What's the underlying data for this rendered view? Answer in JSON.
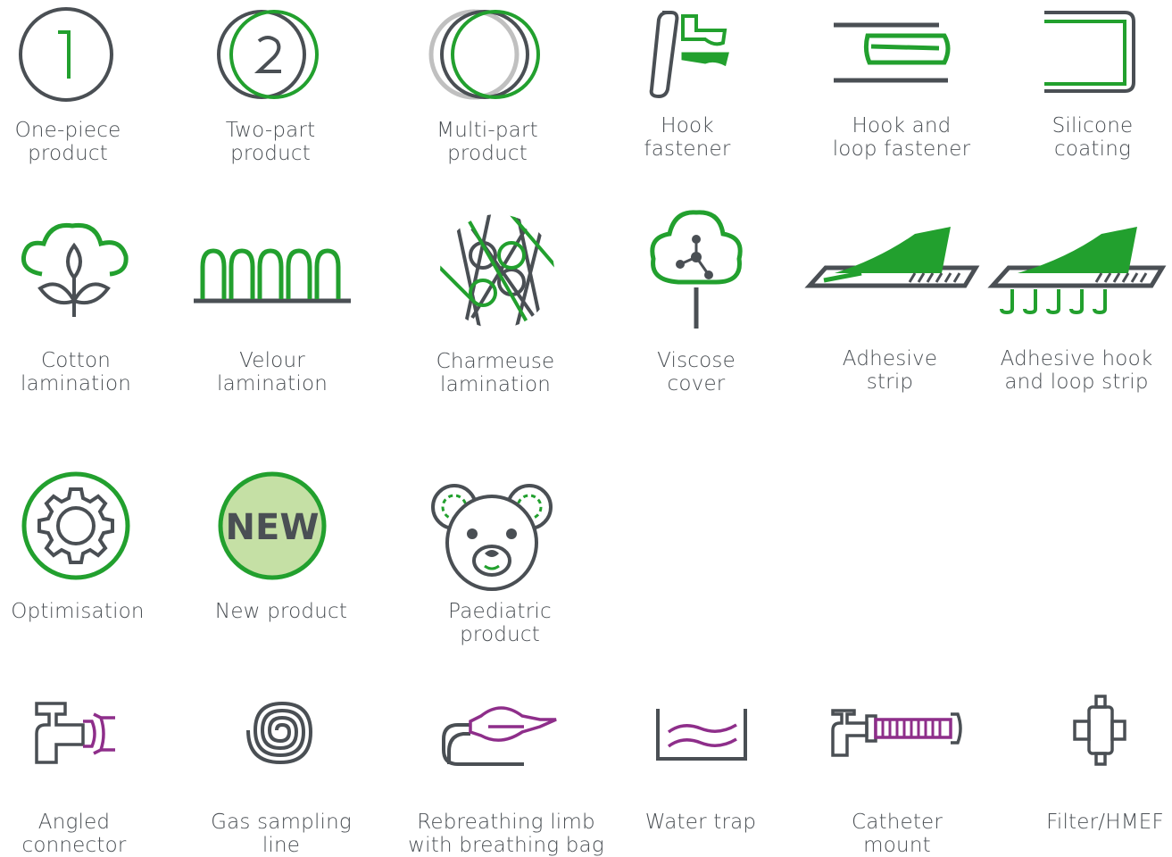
{
  "colors": {
    "dark": "#4a4f54",
    "green": "#22a02e",
    "lightgray": "#c0c0c0",
    "purple": "#8e2e8a",
    "newfill": "#c5e0a5"
  },
  "icons": {
    "one_piece": {
      "line1": "One-piece",
      "line2": "product",
      "icon": "circle-one-icon"
    },
    "two_part": {
      "line1": "Two-part",
      "line2": "product",
      "icon": "circle-two-icon"
    },
    "multi_part": {
      "line1": "Multi-part",
      "line2": "product",
      "icon": "multi-circle-icon"
    },
    "hook": {
      "line1": "Hook",
      "line2": "fastener",
      "icon": "hook-fastener-icon"
    },
    "hook_loop": {
      "line1": "Hook and",
      "line2": "loop fastener",
      "icon": "hook-loop-fastener-icon"
    },
    "silicone": {
      "line1": "Silicone",
      "line2": "coating",
      "icon": "silicone-coating-icon"
    },
    "cotton": {
      "line1": "Cotton",
      "line2": "lamination",
      "icon": "cotton-icon"
    },
    "velour": {
      "line1": "Velour",
      "line2": "lamination",
      "icon": "velour-icon"
    },
    "charmeuse": {
      "line1": "Charmeuse",
      "line2": "lamination",
      "icon": "charmeuse-icon"
    },
    "viscose": {
      "line1": "Viscose",
      "line2": "cover",
      "icon": "viscose-tree-icon"
    },
    "adhesive": {
      "line1": "Adhesive",
      "line2": "strip",
      "icon": "adhesive-strip-icon"
    },
    "adhesive_hl": {
      "line1": "Adhesive hook",
      "line2": "and loop strip",
      "icon": "adhesive-hook-loop-icon"
    },
    "optimisation": {
      "line1": "Optimisation",
      "icon": "gear-icon"
    },
    "new_product": {
      "line1": "New product",
      "badge": "NEW",
      "icon": "new-badge-icon"
    },
    "paediatric": {
      "line1": "Paediatric",
      "line2": "product",
      "icon": "teddy-bear-icon"
    },
    "angled": {
      "line1": "Angled",
      "line2": "connector",
      "icon": "angled-connector-icon"
    },
    "gas_line": {
      "line1": "Gas sampling",
      "line2": "line",
      "icon": "spiral-line-icon"
    },
    "rebreathing": {
      "line1": "Rebreathing limb",
      "line2": "with breathing bag",
      "icon": "breathing-bag-icon"
    },
    "water_trap": {
      "line1": "Water trap",
      "icon": "water-trap-icon"
    },
    "catheter": {
      "line1": "Catheter",
      "line2": "mount",
      "icon": "catheter-mount-icon"
    },
    "filter": {
      "line1": "Filter/HMEF",
      "icon": "filter-icon"
    }
  }
}
